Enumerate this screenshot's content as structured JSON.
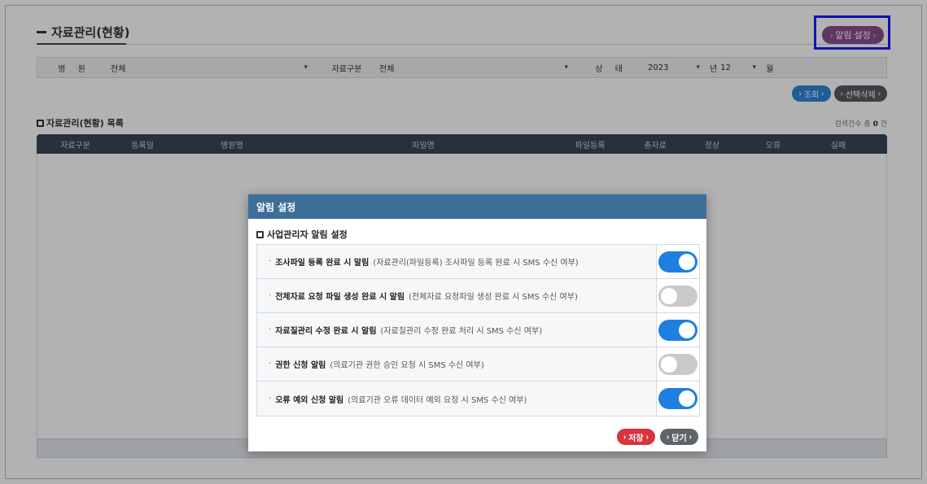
{
  "header": {
    "title": "자료관리(현황)",
    "alarm_button": "알림 설정"
  },
  "filter": {
    "hospital_label": "병 원",
    "hospital_value": "전체",
    "type_label": "자료구분",
    "type_value": "전체",
    "status_label": "상 태",
    "year_value": "2023",
    "year_unit": "년",
    "month_value": "12",
    "month_unit": "월"
  },
  "actions": {
    "search": "조회",
    "delete_selected": "선택삭제"
  },
  "list": {
    "title": "자료관리(현황) 목록",
    "count_prefix": "검색건수 총",
    "count_value": "0",
    "count_suffix": "건",
    "columns": [
      "자료구분",
      "등록일",
      "병원명",
      "파일명",
      "파일등록",
      "총자료",
      "정상",
      "오류",
      "실패"
    ]
  },
  "modal": {
    "title": "알림 설정",
    "subtitle": "사업관리자 알림 설정",
    "options": [
      {
        "main": "조사파일 등록 완료 시 알림",
        "desc": "(자료관리(파일등록) 조사파일 등록 완료 시 SMS 수신 여부)",
        "enabled": true
      },
      {
        "main": "전체자료 요청 파일 생성 완료 시 알림",
        "desc": "(전체자료 요청파일 생성 완료 시 SMS 수신 여부)",
        "enabled": false
      },
      {
        "main": "자료질관리 수정 완료 시 알림",
        "desc": "(자료질관리 수정 완료 처리 시 SMS 수신 여부)",
        "enabled": true
      },
      {
        "main": "권한 신청 알림",
        "desc": "(의료기관 권한 승인 요청 시 SMS 수신 여부)",
        "enabled": false
      },
      {
        "main": "오류 예외 신청 알림",
        "desc": "(의료기관 오류 데이터 예외 요청 시 SMS 수신 여부)",
        "enabled": true
      }
    ],
    "save": "저장",
    "close": "닫기"
  }
}
